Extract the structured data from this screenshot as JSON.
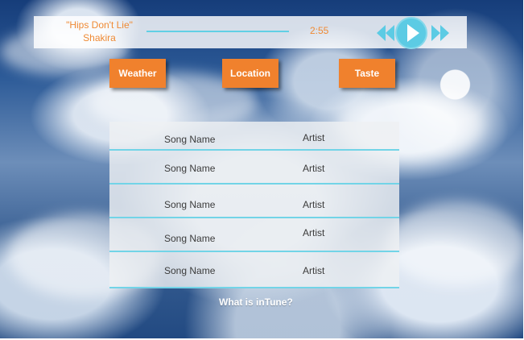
{
  "player": {
    "song_title": "\"Hips Don't Lie\"",
    "artist": "Shakira",
    "time": "2:55",
    "progress_fraction": 0.72
  },
  "buttons": {
    "weather": "Weather",
    "location": "Location",
    "taste": "Taste"
  },
  "song_list": [
    {
      "song": "Song Name",
      "artist": "Artist"
    },
    {
      "song": "Song Name",
      "artist": "Artist"
    },
    {
      "song": "Song Name",
      "artist": "Artist"
    },
    {
      "song": "Song Name",
      "artist": "Artist"
    },
    {
      "song": "Song Name",
      "artist": "Artist"
    }
  ],
  "footer": {
    "help_link": "What is inTune?"
  },
  "icons": {
    "previous": "rewind-icon",
    "play": "play-icon",
    "next": "fast-forward-icon"
  },
  "colors": {
    "accent_orange": "#f0812d",
    "accent_blue": "#5ccbe4",
    "player_text": "#ef8a34"
  }
}
